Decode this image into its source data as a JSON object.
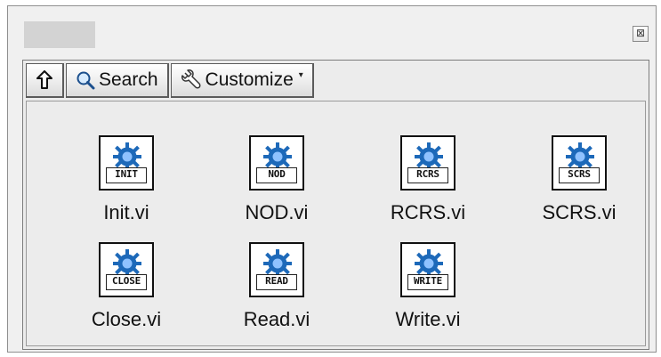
{
  "window": {
    "close_glyph": "⊠"
  },
  "toolbar": {
    "up_icon": "up-arrow-icon",
    "search_label": "Search",
    "search_icon": "magnifier-icon",
    "customize_label": "Customize",
    "customize_icon": "wrench-icon",
    "customize_caret": "▾"
  },
  "items": [
    {
      "code": "INIT",
      "label": "Init.vi"
    },
    {
      "code": "NOD",
      "label": "NOD.vi"
    },
    {
      "code": "RCRS",
      "label": "RCRS.vi"
    },
    {
      "code": "SCRS",
      "label": "SCRS.vi"
    },
    {
      "code": "CLOSE",
      "label": "Close.vi"
    },
    {
      "code": "READ",
      "label": "Read.vi"
    },
    {
      "code": "WRITE",
      "label": "Write.vi"
    }
  ],
  "colors": {
    "gear_blue": "#1d69b9",
    "gear_light": "#8fc2ff",
    "frame_bg": "#ececec"
  }
}
